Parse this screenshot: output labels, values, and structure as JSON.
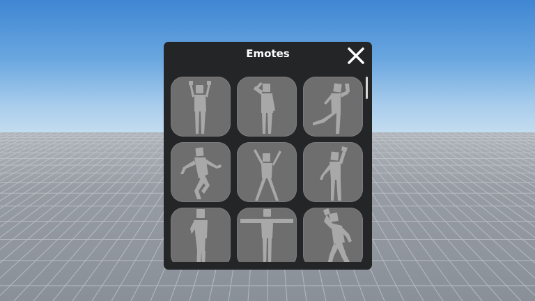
{
  "panel": {
    "title": "Emotes",
    "close_icon": "close-icon"
  },
  "emotes": [
    {
      "icon": "emote-arms-up-icon"
    },
    {
      "icon": "emote-salute-icon"
    },
    {
      "icon": "emote-kick-dance-icon"
    },
    {
      "icon": "emote-lean-dance-icon"
    },
    {
      "icon": "emote-cheer-icon"
    },
    {
      "icon": "emote-point-up-icon"
    },
    {
      "icon": "emote-stand-icon"
    },
    {
      "icon": "emote-t-pose-icon"
    },
    {
      "icon": "emote-wave-dance-icon"
    }
  ],
  "colors": {
    "panel_bg": "#232527",
    "tile_bg": "#6e6e6e",
    "figure": "#a8a8a8",
    "title_text": "#ffffff",
    "sky_top": "#3f86d3",
    "floor": "#8e939b"
  }
}
